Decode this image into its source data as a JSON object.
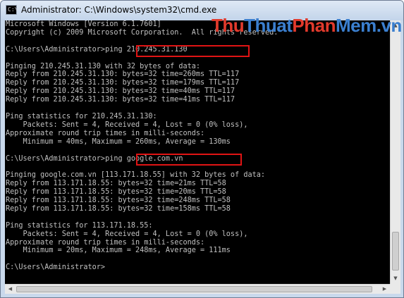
{
  "window": {
    "title": "Administrator: C:\\Windows\\system32\\cmd.exe",
    "icon": "cmd-icon"
  },
  "watermark": {
    "thu1": "Thu",
    "thuat": "Thuat",
    "phan": "Phan",
    "mem": "Mem",
    "vn": ".vn"
  },
  "console": {
    "lines": [
      "Microsoft Windows [Version 6.1.7601]",
      "Copyright (c) 2009 Microsoft Corporation.  All rights reserved.",
      "",
      "C:\\Users\\Administrator>ping 210.245.31.130",
      "",
      "Pinging 210.245.31.130 with 32 bytes of data:",
      "Reply from 210.245.31.130: bytes=32 time=260ms TTL=117",
      "Reply from 210.245.31.130: bytes=32 time=179ms TTL=117",
      "Reply from 210.245.31.130: bytes=32 time=40ms TTL=117",
      "Reply from 210.245.31.130: bytes=32 time=41ms TTL=117",
      "",
      "Ping statistics for 210.245.31.130:",
      "    Packets: Sent = 4, Received = 4, Lost = 0 (0% loss),",
      "Approximate round trip times in milli-seconds:",
      "    Minimum = 40ms, Maximum = 260ms, Average = 130ms",
      "",
      "C:\\Users\\Administrator>ping google.com.vn",
      "",
      "Pinging google.com.vn [113.171.18.55] with 32 bytes of data:",
      "Reply from 113.171.18.55: bytes=32 time=21ms TTL=58",
      "Reply from 113.171.18.55: bytes=32 time=20ms TTL=58",
      "Reply from 113.171.18.55: bytes=32 time=248ms TTL=58",
      "Reply from 113.171.18.55: bytes=32 time=158ms TTL=58",
      "",
      "Ping statistics for 113.171.18.55:",
      "    Packets: Sent = 4, Received = 4, Lost = 0 (0% loss),",
      "Approximate round trip times in milli-seconds:",
      "    Minimum = 20ms, Maximum = 248ms, Average = 111ms",
      "",
      "C:\\Users\\Administrator>"
    ]
  },
  "highlights": {
    "color": "#e01414",
    "commands": [
      "ping 210.245.31.130",
      "ping google.com.vn"
    ]
  },
  "scrollbars": {
    "up_icon": "scroll-up-arrow-icon",
    "down_icon": "scroll-down-arrow-icon",
    "left_icon": "scroll-left-arrow-icon",
    "right_icon": "scroll-right-arrow-icon"
  }
}
